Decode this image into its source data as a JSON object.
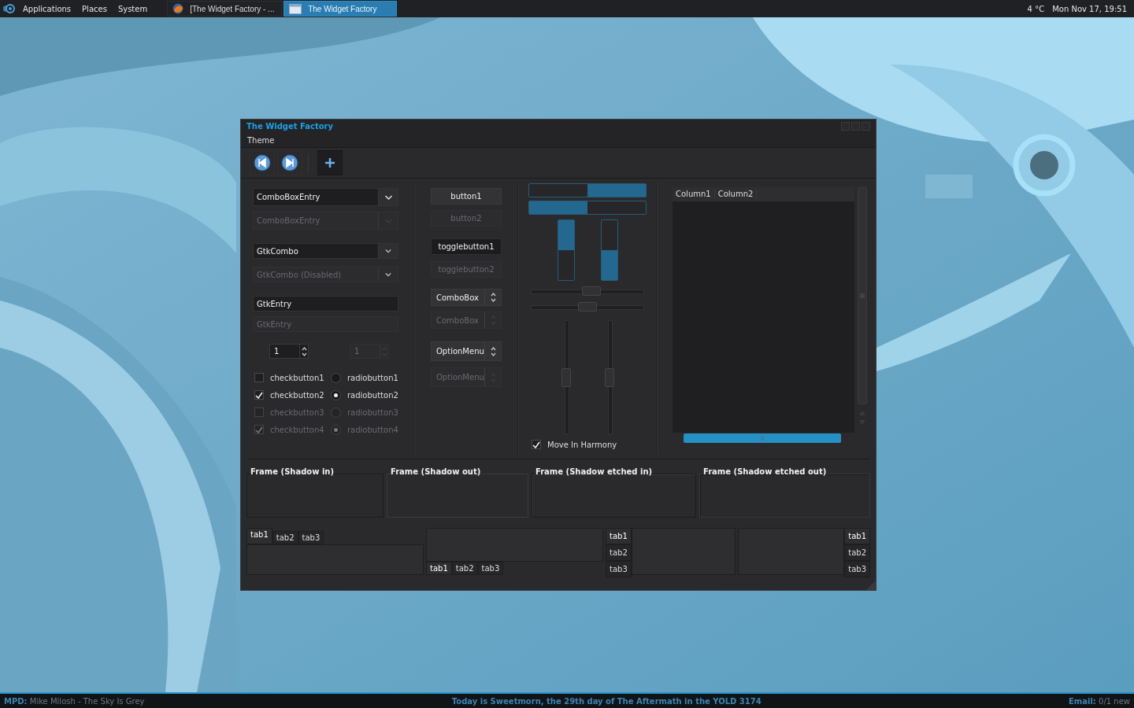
{
  "top_panel": {
    "menus": [
      "Applications",
      "Places",
      "System"
    ],
    "tasks": [
      {
        "title": "[The Widget Factory - ...",
        "kind": "browser",
        "selected": false
      },
      {
        "title": "The Widget Factory",
        "kind": "window",
        "selected": true
      }
    ],
    "weather": "4 °C",
    "clock": "Mon Nov 17, 19:51"
  },
  "window": {
    "title": "The Widget Factory",
    "menu": [
      "Theme"
    ],
    "toolbar": [
      {
        "kind": "back",
        "pressed": false
      },
      {
        "kind": "forward",
        "pressed": false
      },
      {
        "kind": "add",
        "pressed": true
      }
    ],
    "fields": [
      {
        "kind": "combo_entry",
        "value": "ComboBoxEntry",
        "disabled": false
      },
      {
        "kind": "combo_entry",
        "value": "ComboBoxEntry",
        "disabled": true
      },
      {
        "kind": "combo",
        "value": "GtkCombo",
        "disabled": false
      },
      {
        "kind": "combo",
        "value": "GtkCombo (Disabled)",
        "disabled": true
      },
      {
        "kind": "entry",
        "value": "GtkEntry",
        "disabled": false
      },
      {
        "kind": "entry",
        "value": "GtkEntry",
        "disabled": true
      }
    ],
    "spins": [
      {
        "value": "1",
        "disabled": false
      },
      {
        "value": "1",
        "disabled": true
      }
    ],
    "checks": [
      {
        "label": "checkbutton1",
        "checked": false,
        "disabled": false
      },
      {
        "label": "checkbutton2",
        "checked": true,
        "disabled": false
      },
      {
        "label": "checkbutton3",
        "checked": false,
        "disabled": true
      },
      {
        "label": "checkbutton4",
        "checked": true,
        "disabled": true
      }
    ],
    "radios": [
      {
        "label": "radiobutton1",
        "selected": false,
        "disabled": false
      },
      {
        "label": "radiobutton2",
        "selected": true,
        "disabled": false
      },
      {
        "label": "radiobutton3",
        "selected": false,
        "disabled": true
      },
      {
        "label": "radiobutton4",
        "selected": true,
        "disabled": true
      }
    ],
    "buttons": [
      {
        "kind": "button",
        "label": "button1",
        "disabled": false,
        "pressed": false
      },
      {
        "kind": "button",
        "label": "button2",
        "disabled": true,
        "pressed": false
      },
      {
        "kind": "toggle",
        "label": "togglebutton1",
        "disabled": false,
        "pressed": true
      },
      {
        "kind": "toggle",
        "label": "togglebutton2",
        "disabled": true,
        "pressed": false
      },
      {
        "kind": "combobox",
        "label": "ComboBox",
        "disabled": false,
        "pressed": false
      },
      {
        "kind": "combobox",
        "label": "ComboBox",
        "disabled": true,
        "pressed": false
      },
      {
        "kind": "optionmenu",
        "label": "OptionMenu",
        "disabled": false,
        "pressed": false
      },
      {
        "kind": "optionmenu",
        "label": "OptionMenu",
        "disabled": true,
        "pressed": false
      }
    ],
    "progress": [
      {
        "kind": "leftward",
        "level": 0.5
      },
      {
        "kind": "rightward",
        "level": 0.5
      },
      {
        "kind": "downward",
        "level": 0.5
      },
      {
        "kind": "upward",
        "level": 0.5
      }
    ],
    "hsliders": [
      {
        "level": 0.54
      },
      {
        "level": 0.5
      }
    ],
    "vsliders": [
      {
        "level": 0.5
      },
      {
        "level": 0.5
      }
    ],
    "harmony": {
      "label": "Move In Harmony",
      "checked": true
    },
    "tree": {
      "columns": [
        "Column1",
        "Column2"
      ]
    },
    "frames": [
      {
        "label": "Frame (Shadow in)",
        "kind": "in"
      },
      {
        "label": "Frame (Shadow out)",
        "kind": "out"
      },
      {
        "label": "Frame (Shadow etched in)",
        "kind": "etched_in"
      },
      {
        "label": "Frame (Shadow etched out)",
        "kind": "etched_out"
      }
    ],
    "notebooks": [
      {
        "kind": "top",
        "tabs": [
          {
            "label": "tab1",
            "selected": true
          },
          {
            "label": "tab2",
            "selected": false
          },
          {
            "label": "tab3",
            "selected": false
          }
        ]
      },
      {
        "kind": "bottom",
        "tabs": [
          {
            "label": "tab1",
            "selected": true
          },
          {
            "label": "tab2",
            "selected": false
          },
          {
            "label": "tab3",
            "selected": false
          }
        ]
      },
      {
        "kind": "left",
        "tabs": [
          {
            "label": "tab1",
            "selected": true
          },
          {
            "label": "tab2",
            "selected": false
          },
          {
            "label": "tab3",
            "selected": false
          }
        ]
      },
      {
        "kind": "right",
        "tabs": [
          {
            "label": "tab1",
            "selected": true
          },
          {
            "label": "tab2",
            "selected": false
          },
          {
            "label": "tab3",
            "selected": false
          }
        ]
      }
    ]
  },
  "bottom_bar": {
    "left": "**MPD:** Mike Milosh - The Sky Is Grey",
    "center": "Today is Sweetmorn, the 29th day of The Aftermath in the YOLD 3174",
    "right": "**Email:** 0/1 new"
  }
}
